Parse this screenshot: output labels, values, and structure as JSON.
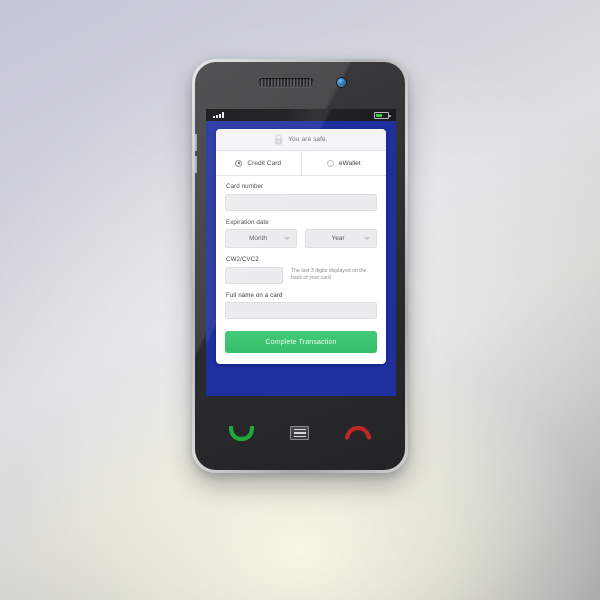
{
  "device": {
    "top": {
      "earpiece_icon": "earpiece-grille",
      "camera_icon": "front-camera-lens"
    },
    "side_buttons": [
      "volume-up-button",
      "volume-down-button"
    ],
    "bottom_buttons": [
      {
        "name": "call-button",
        "icon": "green-phone-handset"
      },
      {
        "name": "menu-button",
        "icon": "hamburger-menu"
      },
      {
        "name": "end-call-button",
        "icon": "red-phone-handset"
      }
    ]
  },
  "statusbar": {
    "signal_icon": "signal-bars",
    "battery_icon": "battery",
    "battery_level": 58
  },
  "screen": {
    "background_color": "#1e2f9e"
  },
  "payment_form": {
    "secure_banner": {
      "icon": "padlock-icon",
      "text": "You are safe."
    },
    "method_tabs": [
      {
        "label": "Credit Card",
        "selected": true
      },
      {
        "label": "eWallet",
        "selected": false
      }
    ],
    "fields": {
      "card_number": {
        "label": "Card number",
        "value": "",
        "placeholder": ""
      },
      "expiration_date": {
        "label": "Expiration date",
        "month": {
          "value": "Month",
          "caret_icon": "chevron-down-icon"
        },
        "year": {
          "value": "Year",
          "caret_icon": "chevron-down-icon"
        }
      },
      "cvc": {
        "label": "CW2/CVC2",
        "value": "",
        "hint": "The last 3 digits displayed on the back of your card"
      },
      "full_name": {
        "label": "Full name on a card",
        "value": "",
        "placeholder": ""
      }
    },
    "submit": {
      "label": "Complete Transaction",
      "color": "#38c16c"
    }
  }
}
